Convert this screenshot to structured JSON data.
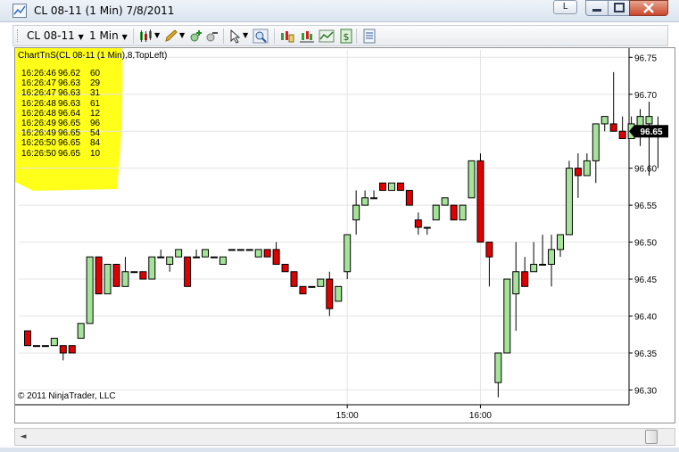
{
  "window": {
    "title": "CL 08-11 (1 Min)  7/8/2011",
    "l_button": "L"
  },
  "toolbar": {
    "instrument": "CL 08-11",
    "period": "1 Min",
    "icons": [
      "bar-type-icon",
      "pencil-icon",
      "zoom-in-icon",
      "zoom-out-icon",
      "cursor-icon",
      "magnify-icon",
      "data-box-icon",
      "indicators-icon",
      "strategies-icon",
      "dollar-icon",
      "properties-icon"
    ]
  },
  "chart": {
    "indicator_label": "ChartTnS(CL 08-11 (1 Min),8,TopLeft)",
    "tns_rows": [
      {
        "time": "16:26:46",
        "price": "96.62",
        "volume": "60"
      },
      {
        "time": "16:26:47",
        "price": "96.63",
        "volume": "29"
      },
      {
        "time": "16:26:47",
        "price": "96.63",
        "volume": "31"
      },
      {
        "time": "16:26:48",
        "price": "96.63",
        "volume": "61"
      },
      {
        "time": "16:26:48",
        "price": "96.64",
        "volume": "12"
      },
      {
        "time": "16:26:49",
        "price": "96.65",
        "volume": "96"
      },
      {
        "time": "16:26:49",
        "price": "96.65",
        "volume": "54"
      },
      {
        "time": "16:26:50",
        "price": "96.65",
        "volume": "84"
      },
      {
        "time": "16:26:50",
        "price": "96.65",
        "volume": "10"
      }
    ],
    "copyright": "© 2011 NinjaTrader, LLC",
    "current_price": "96.65",
    "colors": {
      "up_body": "#a6e39a",
      "down_body": "#e00000",
      "highlight": "#ffff00",
      "price_tag": "#000000"
    }
  },
  "chart_data": {
    "type": "candlestick",
    "ylim": [
      96.28,
      96.76
    ],
    "y_ticks": [
      "96.75",
      "96.70",
      "96.65",
      "96.60",
      "96.55",
      "96.50",
      "96.45",
      "96.40",
      "96.35",
      "96.30"
    ],
    "x_ticks": [
      "15:00",
      "16:00"
    ],
    "x_tick_bar_index": [
      36,
      51
    ],
    "bars": [
      [
        96.38,
        96.38,
        96.36,
        96.36
      ],
      [
        96.36,
        96.36,
        96.36,
        96.36
      ],
      [
        96.36,
        96.36,
        96.36,
        96.36
      ],
      [
        96.36,
        96.37,
        96.36,
        96.37
      ],
      [
        96.36,
        96.36,
        96.34,
        96.35
      ],
      [
        96.36,
        96.36,
        96.35,
        96.35
      ],
      [
        96.37,
        96.39,
        96.37,
        96.39
      ],
      [
        96.39,
        96.48,
        96.39,
        96.48
      ],
      [
        96.48,
        96.48,
        96.43,
        96.43
      ],
      [
        96.43,
        96.47,
        96.43,
        96.47
      ],
      [
        96.47,
        96.47,
        96.44,
        96.44
      ],
      [
        96.44,
        96.48,
        96.44,
        96.46
      ],
      [
        96.46,
        96.46,
        96.46,
        96.46
      ],
      [
        96.46,
        96.46,
        96.45,
        96.45
      ],
      [
        96.45,
        96.48,
        96.45,
        96.48
      ],
      [
        96.48,
        96.49,
        96.48,
        96.48
      ],
      [
        96.47,
        96.48,
        96.46,
        96.48
      ],
      [
        96.48,
        96.49,
        96.48,
        96.49
      ],
      [
        96.48,
        96.48,
        96.44,
        96.44
      ],
      [
        96.48,
        96.49,
        96.48,
        96.48
      ],
      [
        96.48,
        96.49,
        96.48,
        96.49
      ],
      [
        96.48,
        96.48,
        96.48,
        96.48
      ],
      [
        96.47,
        96.48,
        96.47,
        96.48
      ],
      [
        96.49,
        96.49,
        96.49,
        96.49
      ],
      [
        96.49,
        96.49,
        96.49,
        96.49
      ],
      [
        96.49,
        96.49,
        96.49,
        96.49
      ],
      [
        96.48,
        96.49,
        96.48,
        96.49
      ],
      [
        96.49,
        96.49,
        96.48,
        96.48
      ],
      [
        96.49,
        96.5,
        96.47,
        96.47
      ],
      [
        96.47,
        96.47,
        96.46,
        96.46
      ],
      [
        96.46,
        96.46,
        96.44,
        96.44
      ],
      [
        96.44,
        96.44,
        96.43,
        96.43
      ],
      [
        96.44,
        96.44,
        96.44,
        96.44
      ],
      [
        96.44,
        96.45,
        96.44,
        96.45
      ],
      [
        96.45,
        96.46,
        96.4,
        96.41
      ],
      [
        96.42,
        96.44,
        96.42,
        96.44
      ],
      [
        96.46,
        96.51,
        96.45,
        96.51
      ],
      [
        96.53,
        96.57,
        96.51,
        96.55
      ],
      [
        96.55,
        96.57,
        96.55,
        96.56
      ],
      [
        96.56,
        96.57,
        96.56,
        96.56
      ],
      [
        96.58,
        96.58,
        96.57,
        96.57
      ],
      [
        96.57,
        96.58,
        96.57,
        96.58
      ],
      [
        96.58,
        96.58,
        96.57,
        96.57
      ],
      [
        96.57,
        96.57,
        96.55,
        96.55
      ],
      [
        96.53,
        96.54,
        96.51,
        96.52
      ],
      [
        96.52,
        96.52,
        96.51,
        96.52
      ],
      [
        96.53,
        96.55,
        96.53,
        96.55
      ],
      [
        96.55,
        96.56,
        96.55,
        96.56
      ],
      [
        96.55,
        96.55,
        96.53,
        96.53
      ],
      [
        96.53,
        96.55,
        96.53,
        96.55
      ],
      [
        96.56,
        96.61,
        96.56,
        96.61
      ],
      [
        96.61,
        96.62,
        96.5,
        96.5
      ],
      [
        96.5,
        96.5,
        96.44,
        96.48
      ],
      [
        96.31,
        96.34,
        96.29,
        96.35
      ],
      [
        96.35,
        96.45,
        96.35,
        96.45
      ],
      [
        96.43,
        96.5,
        96.38,
        96.46
      ],
      [
        96.46,
        96.48,
        96.44,
        96.44
      ],
      [
        96.46,
        96.5,
        96.46,
        96.47
      ],
      [
        96.47,
        96.51,
        96.47,
        96.47
      ],
      [
        96.47,
        96.51,
        96.44,
        96.49
      ],
      [
        96.49,
        96.5,
        96.48,
        96.51
      ],
      [
        96.51,
        96.61,
        96.51,
        96.6
      ],
      [
        96.6,
        96.62,
        96.56,
        96.59
      ],
      [
        96.59,
        96.62,
        96.59,
        96.61
      ],
      [
        96.61,
        96.66,
        96.58,
        96.66
      ],
      [
        96.66,
        96.67,
        96.65,
        96.67
      ],
      [
        96.66,
        96.73,
        96.66,
        96.65
      ],
      [
        96.65,
        96.67,
        96.64,
        96.64
      ],
      [
        96.64,
        96.67,
        96.64,
        96.66
      ],
      [
        96.65,
        96.68,
        96.63,
        96.67
      ],
      [
        96.66,
        96.69,
        96.59,
        96.67
      ],
      [
        96.65,
        96.67,
        96.6,
        96.65
      ]
    ]
  },
  "scrollbar": {
    "left_arrow": "◄"
  }
}
